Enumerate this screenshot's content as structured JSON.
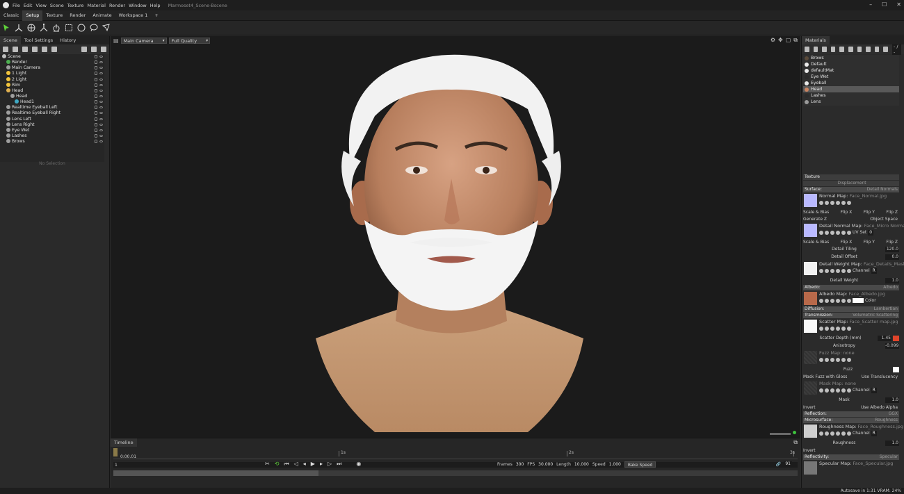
{
  "app": {
    "menu": [
      "File",
      "Edit",
      "View",
      "Scene",
      "Texture",
      "Material",
      "Render",
      "Window",
      "Help"
    ],
    "document_title": "Marmoset4_Scene-Bscene"
  },
  "workspace_tabs": [
    "Classic",
    "Setup",
    "Texture",
    "Render",
    "Animate",
    "Workspace 1",
    "+"
  ],
  "left_panel": {
    "tabs": [
      "Scene",
      "Tool Settings",
      "History"
    ],
    "tree": [
      {
        "label": "Scene",
        "indent": 0,
        "color": "#bfbfbf"
      },
      {
        "label": "Render",
        "indent": 1,
        "color": "#4caf50"
      },
      {
        "label": "Main Camera",
        "indent": 1,
        "color": "#9e9e9e"
      },
      {
        "label": "1 Light",
        "indent": 1,
        "color": "#f0c33c"
      },
      {
        "label": "2 Light",
        "indent": 1,
        "color": "#f0c33c"
      },
      {
        "label": "Rim",
        "indent": 1,
        "color": "#f0c33c"
      },
      {
        "label": "Head",
        "indent": 1,
        "color": "#e0b050"
      },
      {
        "label": "Head",
        "indent": 2,
        "color": "#9e9e9e"
      },
      {
        "label": "Head1",
        "indent": 3,
        "color": "#3fa9c4"
      },
      {
        "label": "Realtime Eyeball Left",
        "indent": 1,
        "color": "#9e9e9e"
      },
      {
        "label": "Realtime Eyeball Right",
        "indent": 1,
        "color": "#9e9e9e"
      },
      {
        "label": "Lens Left",
        "indent": 1,
        "color": "#9e9e9e"
      },
      {
        "label": "Lens Right",
        "indent": 1,
        "color": "#9e9e9e"
      },
      {
        "label": "Eye Wet",
        "indent": 1,
        "color": "#9e9e9e"
      },
      {
        "label": "Lashes",
        "indent": 1,
        "color": "#9e9e9e"
      },
      {
        "label": "Brows",
        "indent": 1,
        "color": "#9e9e9e"
      }
    ],
    "no_selection": "No Selection"
  },
  "viewport": {
    "camera": "Main Camera",
    "quality": "Full Quality"
  },
  "timeline": {
    "tab": "Timeline",
    "ruler_labels": [
      "1s",
      "2s",
      "3s"
    ],
    "current_time": "0:00.01",
    "frame": "1",
    "frames_label": "Frames",
    "frames": "300",
    "fps_label": "FPS",
    "fps": "30.000",
    "length_label": "Length",
    "length": "10.000",
    "speed_label": "Speed",
    "speed": "1.000",
    "bake_speed": "Bake Speed",
    "end_frame": "91",
    "playback_progress": 0.3
  },
  "materials_panel": {
    "title": "Materials",
    "counter": "- / -",
    "materials": [
      {
        "name": "Brows",
        "color": "#5a4a3a"
      },
      {
        "name": "Default",
        "color": "#eaeaea"
      },
      {
        "name": "defaultMat",
        "color": "#eaeaea"
      },
      {
        "name": "Eye Wet",
        "color": "#2b2b2b"
      },
      {
        "name": "Eyeball",
        "color": "#e8e8e8"
      },
      {
        "name": "Head",
        "color": "#c98360"
      },
      {
        "name": "Lashes",
        "color": "#2b2b2b"
      },
      {
        "name": "Lens",
        "color": "#9a9a9a"
      }
    ]
  },
  "properties": {
    "texture": "Texture",
    "displacement": "Displacement",
    "surface": {
      "label": "Surface:",
      "value": "Detail Normals"
    },
    "normal_map": {
      "label": "Normal Map:",
      "file": "Face_Normal.jpg"
    },
    "scale_bias": "Scale & Bias",
    "flip_x": "Flip X",
    "flip_y": "Flip Y",
    "flip_z": "Flip Z",
    "generate_z": "Generate Z",
    "object_space": "Object Space",
    "detail_normal_map": {
      "label": "Detail Normal Map:",
      "file": "Face_Micro Normal.jpg"
    },
    "uv_set": "UV Set",
    "uv_set_value": "0",
    "detail_tiling": {
      "label": "Detail Tiling",
      "value": "120.0"
    },
    "detail_offset": {
      "label": "Detail Offset",
      "value": "0.0"
    },
    "detail_weight_map": {
      "label": "Detail Weight Map:",
      "file": "Face_Details_Mask.jpg"
    },
    "channel": "Channel",
    "channel_value": "R",
    "detail_weight": {
      "label": "Detail Weight",
      "value": "1.0"
    },
    "albedo": {
      "label": "Albedo:",
      "value": "Albedo"
    },
    "albedo_map": {
      "label": "Albedo Map:",
      "file": "Face_Albedo.jpg"
    },
    "color": "Color",
    "diffusion": {
      "label": "Diffusion:",
      "value": "Lambertian"
    },
    "transmission": {
      "label": "Transmission:",
      "value": "Volumetric Scattering"
    },
    "scatter_map": {
      "label": "Scatter Map:",
      "file": "Face_Scatter map.jpg"
    },
    "scatter_depth": {
      "label": "Scatter Depth (mm)",
      "value": "1.45"
    },
    "anisotropy": {
      "label": "Anisotropy",
      "value": "-0.099"
    },
    "fuzz_map": {
      "label": "Fuzz Map:",
      "file": "none"
    },
    "fuzz": "Fuzz",
    "mask_fuzz": "Mask Fuzz with Gloss",
    "use_translucency": "Use Translucency",
    "mask_map": {
      "label": "Mask Map:",
      "file": "none"
    },
    "mask": {
      "label": "Mask",
      "value": "1.0"
    },
    "invert": "Invert",
    "use_albedo_alpha": "Use Albedo Alpha",
    "reflection": {
      "label": "Reflection:",
      "value": "GGX"
    },
    "microsurface": {
      "label": "Microsurface:",
      "value": "Roughness"
    },
    "roughness_map": {
      "label": "Roughness Map:",
      "file": "Face_Roughness.jpg"
    },
    "roughness": {
      "label": "Roughness",
      "value": "1.0"
    },
    "reflectivity": {
      "label": "Reflectivity:",
      "value": "Specular"
    },
    "specular_map": {
      "label": "Specular Map:",
      "file": "Face_Specular.jpg"
    },
    "colors": {
      "scatter": "#e0442a",
      "normal_swatch": "#b9b9ff",
      "albedo_swatch": "#b8694a"
    }
  },
  "status": "Autosave in 1:31   VRAM: 24%"
}
